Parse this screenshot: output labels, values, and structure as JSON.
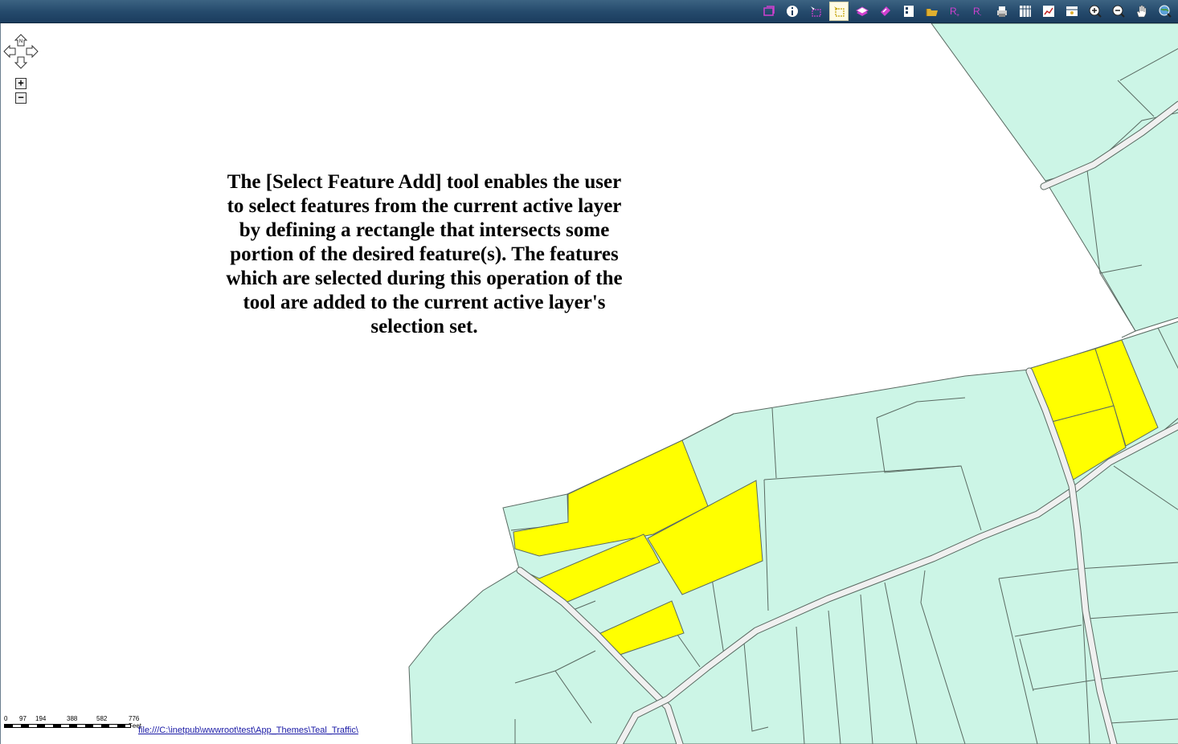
{
  "toolbar": {
    "tools": [
      {
        "name": "clear-selection-icon",
        "color": "#d040d0"
      },
      {
        "name": "identify-icon",
        "color": "#ffffff"
      },
      {
        "name": "select-rectangle-icon",
        "color": "#d040d0"
      },
      {
        "name": "select-feature-add-icon",
        "color": "#c0a000",
        "active": true
      },
      {
        "name": "layers-icon",
        "color": "#d040d0"
      },
      {
        "name": "select-by-attribute-icon",
        "color": "#d040d0"
      },
      {
        "name": "legend-icon",
        "color": "#ffffff"
      },
      {
        "name": "open-folder-icon",
        "color": "#e0b030"
      },
      {
        "name": "query-icon",
        "color": "#d040d0"
      },
      {
        "name": "query-layer-icon",
        "color": "#d040d0"
      },
      {
        "name": "print-icon",
        "color": "#cccccc"
      },
      {
        "name": "attribute-table-icon",
        "color": "#ffffff"
      },
      {
        "name": "chart-icon",
        "color": "#ffffff"
      },
      {
        "name": "map-tips-icon",
        "color": "#ffffff"
      },
      {
        "name": "zoom-in-icon",
        "color": "#ffffff"
      },
      {
        "name": "zoom-out-icon",
        "color": "#ffffff"
      },
      {
        "name": "pan-hand-icon",
        "color": "#ffffff"
      },
      {
        "name": "full-extent-icon",
        "color": "#ffffff"
      }
    ]
  },
  "map": {
    "parcel_fill": "#ccf5e6",
    "selected_fill": "#ffff00",
    "road_fill": "#f0f0f0",
    "outline": "#5a6a62"
  },
  "caption": {
    "text": "The [Select Feature Add] tool enables the user\nto select features from the current active layer\nby defining a rectangle that intersects some\nportion of the desired feature(s).  The features\nwhich are selected during this operation of the\ntool are added to the current active layer's\nselection set."
  },
  "navigation": {
    "north_label": "N",
    "zoom_in_label": "+",
    "zoom_out_label": "−"
  },
  "scale_bar": {
    "labels": [
      "0",
      "97",
      "194",
      "388",
      "582",
      "776 Feet"
    ]
  },
  "status": {
    "path_link": "file:///C:\\inetpub\\wwwroot\\test\\App_Themes\\Teal_Traffic\\"
  }
}
